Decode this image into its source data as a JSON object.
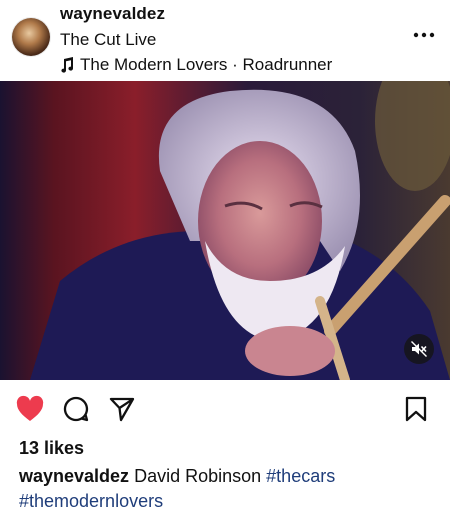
{
  "post": {
    "username": "waynevaldez",
    "location": "The Cut Live",
    "audio": "The Modern Lovers · Roadrunner",
    "likes": "13 likes",
    "caption_user": "waynevaldez",
    "caption_text": "David Robinson",
    "hashtags": [
      "#thecars",
      "#themodernlovers"
    ]
  },
  "colors": {
    "like": "#ed3b4e",
    "hashtag": "#1f3d7a",
    "text": "#111111"
  },
  "icons": [
    "more-options-icon",
    "music-note-icon",
    "mute-icon",
    "heart-icon",
    "comment-icon",
    "share-icon",
    "bookmark-icon"
  ]
}
